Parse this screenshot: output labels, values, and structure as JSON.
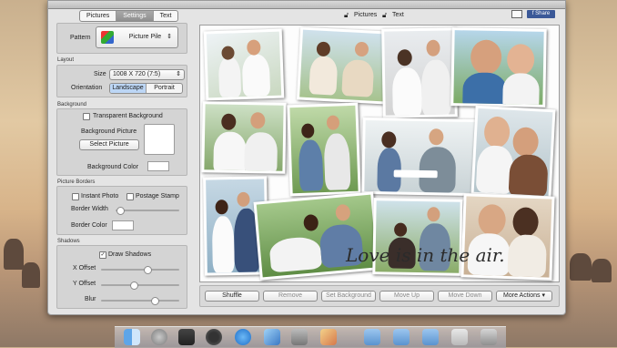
{
  "window": {
    "title": ""
  },
  "tabs": [
    "Pictures",
    "Settings",
    "Text"
  ],
  "pattern": {
    "label": "Pattern",
    "value": "Picture Pile"
  },
  "layout": {
    "section": "Layout",
    "size_label": "Size",
    "size_value": "1008 X 720 (7:5)",
    "orientation_label": "Orientation",
    "landscape": "Landscape",
    "portrait": "Portrait"
  },
  "background": {
    "section": "Background",
    "transparent": "Transparent Background",
    "picture_label": "Background Picture",
    "select_button": "Select Picture",
    "color_label": "Background Color"
  },
  "borders": {
    "section": "Picture Borders",
    "instant_photo": "Instant Photo",
    "postage_stamp": "Postage Stamp",
    "width_label": "Border Width",
    "color_label": "Border Color"
  },
  "shadows": {
    "section": "Shadows",
    "draw": "Draw Shadows",
    "x_offset": "X Offset",
    "y_offset": "Y Offset",
    "blur": "Blur"
  },
  "toolbar": {
    "pictures": "Pictures",
    "text": "Text",
    "facebook": "f Share"
  },
  "canvas": {
    "caption": "Love is in the air."
  },
  "actions": [
    "Shuffle",
    "Remove",
    "Set Background",
    "Move Up",
    "Move Down",
    "More Actions"
  ],
  "colors": {
    "selected_tab": "#8f8f8f",
    "facebook": "#3b5998",
    "orientation_selected": "#bcd6f5"
  },
  "sliders": {
    "x_offset": 0.55,
    "y_offset": 0.4,
    "blur": 0.6,
    "border_width": 0.05
  }
}
